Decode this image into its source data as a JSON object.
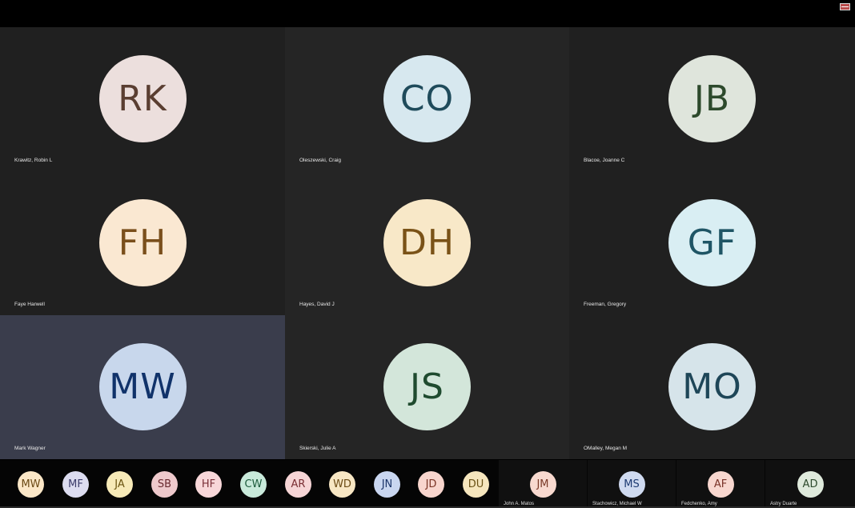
{
  "tiles": [
    {
      "initials": "RK",
      "name": "Krawitz, Robin L",
      "bg": "#ecdfdd",
      "fg": "#5a3e31",
      "tone": "dark"
    },
    {
      "initials": "CO",
      "name": "Oleszewski, Craig",
      "bg": "#d7e8ef",
      "fg": "#1f4b5b",
      "tone": "mid"
    },
    {
      "initials": "JB",
      "name": "Blacoe, Joanne C",
      "bg": "#dfe5dc",
      "fg": "#2d4a2c",
      "tone": "dark"
    },
    {
      "initials": "FH",
      "name": "Faye Harwell",
      "bg": "#fae8d2",
      "fg": "#7a4f1c",
      "tone": "dark"
    },
    {
      "initials": "DH",
      "name": "Hayes, David J",
      "bg": "#f8e8c8",
      "fg": "#7a5217",
      "tone": "mid"
    },
    {
      "initials": "GF",
      "name": "Freeman, Gregory",
      "bg": "#d9eef3",
      "fg": "#1f5565",
      "tone": "dark"
    },
    {
      "initials": "MW",
      "name": "Mark Wagner",
      "bg": "#c8d7ec",
      "fg": "#10326a",
      "tone": "active"
    },
    {
      "initials": "JS",
      "name": "Skierski, Julie A",
      "bg": "#d3e6da",
      "fg": "#1f4b2f",
      "tone": "mid"
    },
    {
      "initials": "MO",
      "name": "OMalley, Megan M",
      "bg": "#d6e4ea",
      "fg": "#1e4658",
      "tone": "dark"
    }
  ],
  "strip_avatars": [
    {
      "initials": "MW",
      "bg": "#fbe7c7",
      "fg": "#6b4a15"
    },
    {
      "initials": "MF",
      "bg": "#dcdcf0",
      "fg": "#3b3b6a"
    },
    {
      "initials": "JA",
      "bg": "#f7eab8",
      "fg": "#6a5410"
    },
    {
      "initials": "SB",
      "bg": "#eec9cc",
      "fg": "#6a2a30"
    },
    {
      "initials": "HF",
      "bg": "#f8d7d9",
      "fg": "#7a2f38"
    },
    {
      "initials": "CW",
      "bg": "#c9eadb",
      "fg": "#1c5a3c"
    },
    {
      "initials": "AR",
      "bg": "#f6d5d6",
      "fg": "#7a2e33"
    },
    {
      "initials": "WD",
      "bg": "#f8e7c4",
      "fg": "#6b4b14"
    },
    {
      "initials": "JN",
      "bg": "#c9d6f0",
      "fg": "#1c356a"
    },
    {
      "initials": "JD",
      "bg": "#f8d5cd",
      "fg": "#7a3425"
    },
    {
      "initials": "DU",
      "bg": "#f6e6bd",
      "fg": "#6a5216"
    }
  ],
  "strip_video_tiles": [
    {
      "initials": "JM",
      "name": "John A. Matos",
      "bg": "#f8d9cf",
      "fg": "#7a3a28"
    },
    {
      "initials": "MS",
      "name": "Stachowicz, Michael W",
      "bg": "#cfdaf0",
      "fg": "#1d3a72"
    },
    {
      "initials": "AF",
      "name": "Fedchenko, Amy",
      "bg": "#f8d7cf",
      "fg": "#7a3328"
    },
    {
      "initials": "AD",
      "name": "Astry Duarte",
      "bg": "#dfeadc",
      "fg": "#2d4a2c"
    }
  ]
}
